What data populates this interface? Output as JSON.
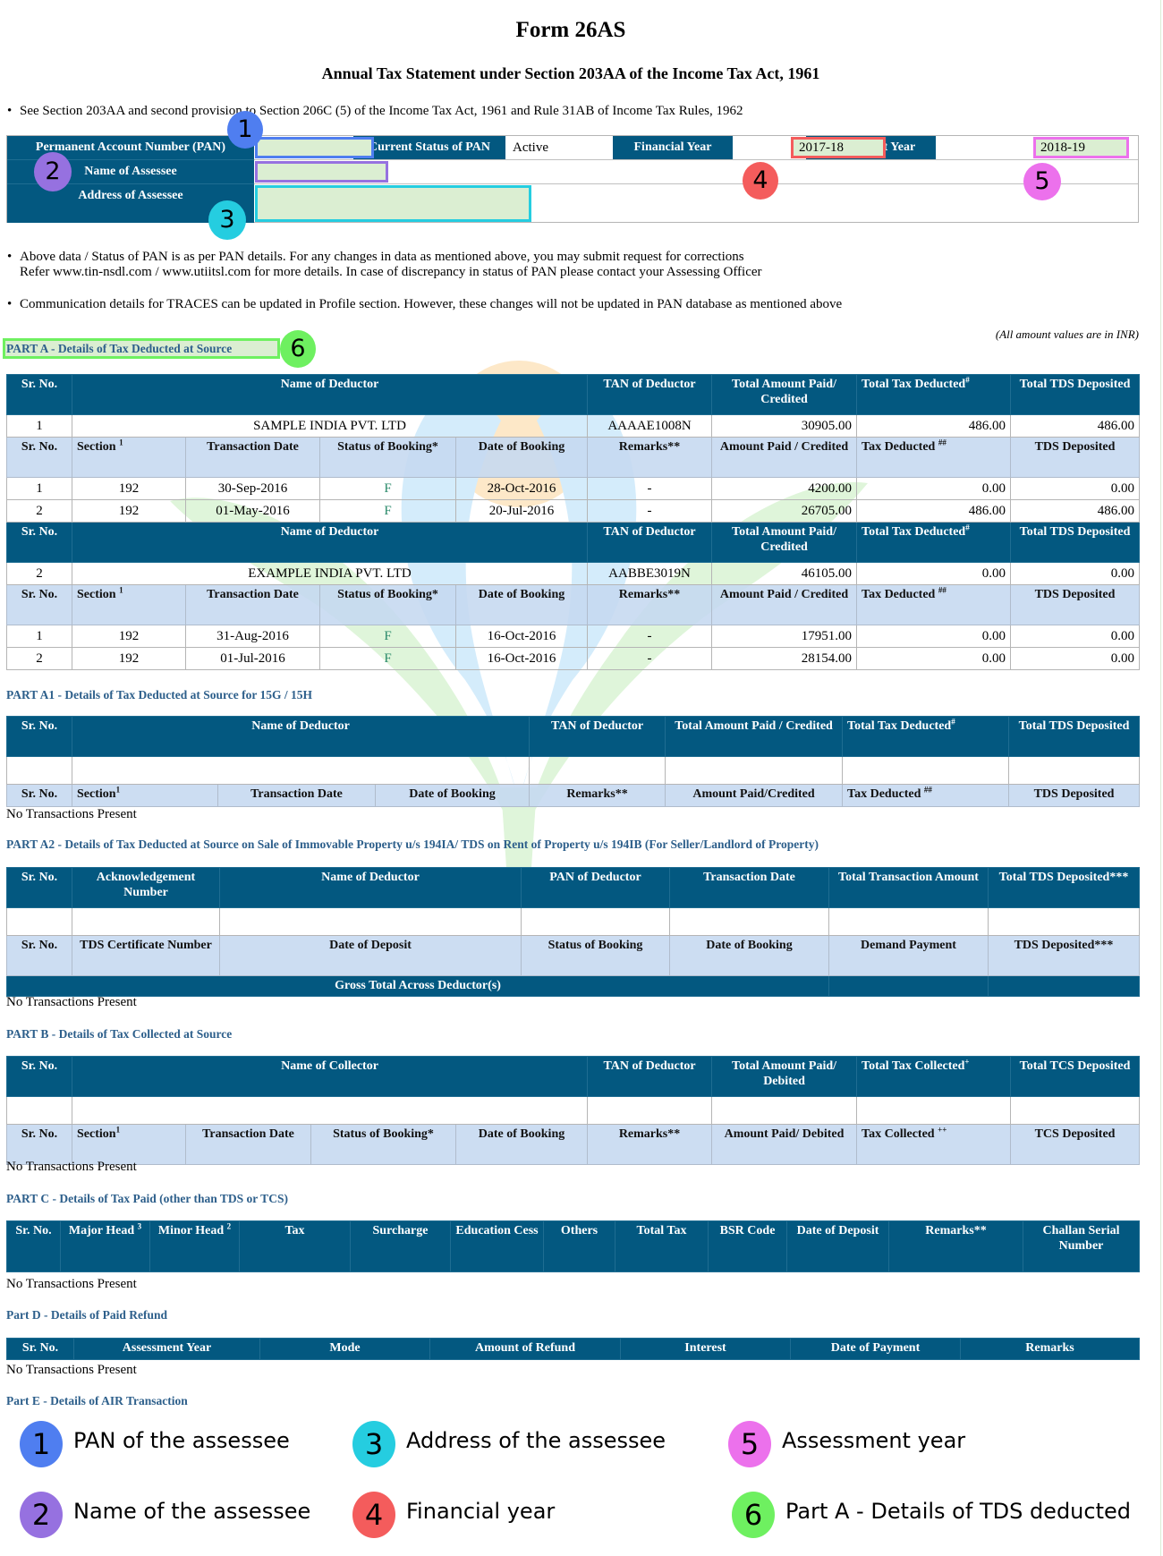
{
  "header": {
    "title": "Form 26AS",
    "subtitle": "Annual Tax Statement under Section 203AA of the Income Tax Act, 1961",
    "note_1": "See Section 203AA and second provision to Section 206C (5) of the Income Tax Act, 1961 and Rule 31AB of Income Tax Rules, 1962"
  },
  "assessee": {
    "pan_label": "Permanent Account Number (PAN)",
    "pan_value": "",
    "status_label": "Current Status of PAN",
    "status_value": "Active",
    "fy_label": "Financial Year",
    "fy_value": "2017-18",
    "ay_label": "Assessment Year",
    "ay_value": "2018-19",
    "name_label": "Name of Assessee",
    "name_value": "",
    "address_label": "Address of Assessee",
    "address_value": ""
  },
  "notes": {
    "note_2_line1": "Above data / Status of PAN is as per PAN details. For any changes in data as mentioned above, you may submit request for corrections",
    "note_2_line2": "Refer www.tin-nsdl.com / www.utiitsl.com for more details. In case of discrepancy in status of PAN please contact your Assessing Officer",
    "note_3": "Communication details for TRACES can be updated in Profile section. However, these changes will not be updated in PAN database as mentioned above",
    "inr_note": "(All amount values are in INR)"
  },
  "part_a": {
    "heading": "PART A - Details of Tax Deducted at Source",
    "header_cols": [
      "Sr. No.",
      "Name of Deductor",
      "TAN of Deductor",
      "Total Amount Paid/ Credited",
      "Total Tax Deducted",
      "Total TDS Deposited"
    ],
    "header_sups": {
      "total_tax_deducted": "#"
    },
    "sub_cols": [
      "Sr. No.",
      "Section",
      "Transaction Date",
      "Status of Booking*",
      "Date of Booking",
      "Remarks**",
      "Amount Paid / Credited",
      "Tax Deducted",
      "TDS Deposited"
    ],
    "sub_sups": {
      "section": "1",
      "tax_deducted": "##"
    },
    "deductors": [
      {
        "sr": "1",
        "name": "SAMPLE INDIA PVT. LTD",
        "tan": "AAAAE1008N",
        "total_paid": "30905.00",
        "total_deducted": "486.00",
        "total_deposited": "486.00",
        "transactions": [
          {
            "sr": "1",
            "section": "192",
            "txn_date": "30-Sep-2016",
            "status": "F",
            "booking_date": "28-Oct-2016",
            "remarks": "-",
            "amount": "4200.00",
            "deducted": "0.00",
            "deposited": "0.00"
          },
          {
            "sr": "2",
            "section": "192",
            "txn_date": "01-May-2016",
            "status": "F",
            "booking_date": "20-Jul-2016",
            "remarks": "-",
            "amount": "26705.00",
            "deducted": "486.00",
            "deposited": "486.00"
          }
        ]
      },
      {
        "sr": "2",
        "name": "EXAMPLE INDIA PVT. LTD",
        "tan": "AABBE3019N",
        "total_paid": "46105.00",
        "total_deducted": "0.00",
        "total_deposited": "0.00",
        "transactions": [
          {
            "sr": "1",
            "section": "192",
            "txn_date": "31-Aug-2016",
            "status": "F",
            "booking_date": "16-Oct-2016",
            "remarks": "-",
            "amount": "17951.00",
            "deducted": "0.00",
            "deposited": "0.00"
          },
          {
            "sr": "2",
            "section": "192",
            "txn_date": "01-Jul-2016",
            "status": "F",
            "booking_date": "16-Oct-2016",
            "remarks": "-",
            "amount": "28154.00",
            "deducted": "0.00",
            "deposited": "0.00"
          }
        ]
      }
    ]
  },
  "part_a1": {
    "heading": "PART A1 - Details of Tax Deducted at Source for 15G / 15H",
    "header_cols": [
      "Sr. No.",
      "Name of Deductor",
      "TAN of Deductor",
      "Total Amount Paid / Credited",
      "Total Tax Deducted",
      "Total TDS Deposited"
    ],
    "sub_cols": [
      "Sr. No.",
      "Section",
      "Transaction Date",
      "Date of Booking",
      "Remarks**",
      "Amount Paid/Credited",
      "Tax Deducted",
      "TDS Deposited"
    ],
    "empty_text": "No Transactions Present"
  },
  "part_a2": {
    "heading": "PART A2 - Details of Tax Deducted at Source on Sale of Immovable Property u/s 194IA/ TDS on Rent of Property u/s 194IB (For Seller/Landlord of Property)",
    "header_cols": [
      "Sr. No.",
      "Acknowledgement Number",
      "Name of Deductor",
      "PAN of  Deductor",
      "Transaction Date",
      "Total Transaction Amount",
      "Total TDS Deposited***"
    ],
    "sub_cols": [
      "Sr. No.",
      "TDS Certificate Number",
      "Date of Deposit",
      "Status of Booking",
      "Date of Booking",
      "Demand Payment",
      "TDS Deposited***"
    ],
    "gross_total_label": "Gross Total Across Deductor(s)",
    "empty_text": "No Transactions Present"
  },
  "part_b": {
    "heading": "PART B - Details of Tax Collected at Source",
    "header_cols": [
      "Sr. No.",
      "Name of Collector",
      "TAN of  Deductor",
      "Total Amount Paid/ Debited",
      "Total Tax Collected",
      "Total TCS Deposited"
    ],
    "sub_cols": [
      "Sr. No.",
      "Section",
      "Transaction Date",
      "Status of Booking*",
      "Date of Booking",
      "Remarks**",
      "Amount Paid/ Debited",
      "Tax Collected",
      "TCS Deposited"
    ],
    "empty_text": "No Transactions Present"
  },
  "part_c": {
    "heading": "PART C - Details of Tax Paid (other than TDS or TCS)",
    "header_cols": [
      "Sr. No.",
      "Major Head",
      "Minor Head",
      "Tax",
      "Surcharge",
      "Education Cess",
      "Others",
      "Total Tax",
      "BSR Code",
      "Date of Deposit",
      "Remarks**",
      "Challan Serial Number"
    ],
    "empty_text": "No Transactions Present"
  },
  "part_d": {
    "heading": "Part D - Details of Paid Refund",
    "header_cols": [
      "Sr. No.",
      "Assessment Year",
      "Mode",
      "Amount of Refund",
      "Interest",
      "Date of Payment",
      "Remarks"
    ],
    "empty_text": "No Transactions Present"
  },
  "part_e": {
    "heading": "Part E - Details of AIR Transaction"
  },
  "legend": [
    {
      "num": "1",
      "label": "PAN of the assessee",
      "color": "#4f7ef0"
    },
    {
      "num": "2",
      "label": "Name of the assessee",
      "color": "#9671e0"
    },
    {
      "num": "3",
      "label": "Address of the assessee",
      "color": "#25cde0"
    },
    {
      "num": "4",
      "label": "Financial year",
      "color": "#f45c5c"
    },
    {
      "num": "5",
      "label": "Assessment year",
      "color": "#ec71ec"
    },
    {
      "num": "6",
      "label": "Part A - Details of TDS deducted",
      "color": "#6ef060"
    }
  ],
  "colors": {
    "header_blue": "#035880",
    "subheader_blue": "#c5d8f0",
    "section_heading": "#2d5f8b",
    "highlight_fill": "#dbeed2"
  }
}
